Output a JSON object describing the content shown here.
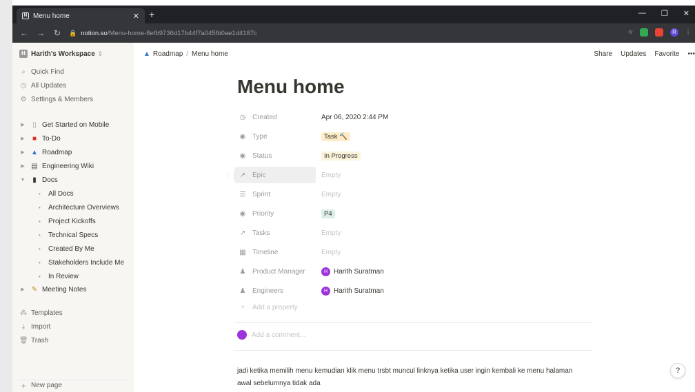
{
  "browser": {
    "tab_title": "Menu home",
    "url_host": "notion.so",
    "url_path": "/Menu-home-8efb9736d17b44f7a045fb0ae1d4187c",
    "ext_avatar": "R"
  },
  "sidebar": {
    "workspace": "Harith's Workspace",
    "workspace_initial": "H",
    "quick_links": [
      {
        "label": "Quick Find",
        "icon": "search-icon"
      },
      {
        "label": "All Updates",
        "icon": "clock-icon"
      },
      {
        "label": "Settings & Members",
        "icon": "gear-icon"
      }
    ],
    "pages": [
      {
        "label": "Get Started on Mobile",
        "icon": "page-icon"
      },
      {
        "label": "To-Do",
        "icon": "todo-icon"
      },
      {
        "label": "Roadmap",
        "icon": "car-icon"
      },
      {
        "label": "Engineering Wiki",
        "icon": "book-icon"
      },
      {
        "label": "Docs",
        "icon": "doc-icon"
      }
    ],
    "docs_children": [
      "All Docs",
      "Architecture Overviews",
      "Project Kickoffs",
      "Technical Specs",
      "Created By Me",
      "Stakeholders Include Me",
      "In Review"
    ],
    "meeting_notes": "Meeting Notes",
    "bottom_links": [
      {
        "label": "Templates",
        "icon": "templates-icon"
      },
      {
        "label": "Import",
        "icon": "import-icon"
      },
      {
        "label": "Trash",
        "icon": "trash-icon"
      }
    ],
    "new_page": "New page"
  },
  "topbar": {
    "breadcrumb": [
      "Roadmap",
      "Menu home"
    ],
    "actions": [
      "Share",
      "Updates",
      "Favorite",
      "•••"
    ]
  },
  "page": {
    "title": "Menu home",
    "properties": [
      {
        "name": "Created",
        "icon": "clock-icon",
        "value": "Apr 06, 2020 2:44 PM"
      },
      {
        "name": "Type",
        "icon": "select-icon",
        "value": "Task 🔨"
      },
      {
        "name": "Status",
        "icon": "select-icon",
        "value": "In Progress"
      },
      {
        "name": "Epic",
        "icon": "relation-icon",
        "value": "Empty"
      },
      {
        "name": "Sprint",
        "icon": "list-icon",
        "value": "Empty"
      },
      {
        "name": "Priority",
        "icon": "select-icon",
        "value": "P4"
      },
      {
        "name": "Tasks",
        "icon": "relation-icon",
        "value": "Empty"
      },
      {
        "name": "Timeline",
        "icon": "calendar-icon",
        "value": "Empty"
      },
      {
        "name": "Product Manager",
        "icon": "people-icon",
        "value": "Harith Suratman"
      },
      {
        "name": "Engineers",
        "icon": "people-icon",
        "value": "Harith Suratman"
      }
    ],
    "add_property": "Add a property",
    "add_comment": "Add a comment...",
    "body": "jadi ketika memilih menu kemudian klik menu trsbt muncul linknya ketika user ingin kembali ke menu halaman awal sebelumnya tidak ada"
  },
  "help_label": "?",
  "colors": {
    "sidebar_bg": "#f7f6f3",
    "accent_purple": "#9d34da",
    "task_tag": "#fdecc8",
    "progress_tag": "#fbf3db",
    "priority_tag": "#ddedea"
  }
}
